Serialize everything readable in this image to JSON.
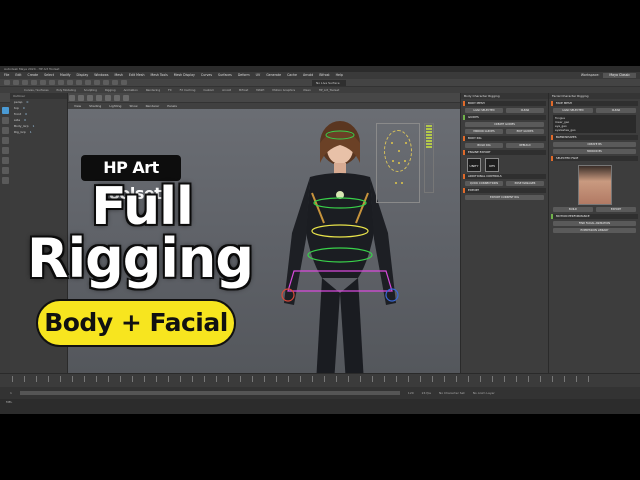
{
  "titlebar": {
    "text": "Autodesk Maya 2024 - HP Art Toolset"
  },
  "menu": {
    "items": [
      "File",
      "Edit",
      "Create",
      "Select",
      "Modify",
      "Display",
      "Windows",
      "Mesh",
      "Edit Mesh",
      "Mesh Tools",
      "Mesh Display",
      "Curves",
      "Surfaces",
      "Deform",
      "UV",
      "Generate",
      "Cache",
      "Arnold",
      "Bifrost",
      "Help"
    ],
    "workspace_label": "Workspace:",
    "workspace_value": "Maya Classic"
  },
  "live_surface": "No Live Surface",
  "shelf_tabs": [
    "Curves / Surfaces",
    "Poly Modeling",
    "Sculpting",
    "Rigging",
    "Animation",
    "Rendering",
    "FX",
    "FX Caching",
    "Custom",
    "Arnold",
    "Bifrost",
    "MASH",
    "Motion Graphics",
    "XGen",
    "HP_Art_Toolset"
  ],
  "outliner": {
    "header": "Outliner",
    "rows": [
      {
        "name": "persp",
        "v": "0"
      },
      {
        "name": "top",
        "v": "0"
      },
      {
        "name": "front",
        "v": "0"
      },
      {
        "name": "side",
        "v": "0"
      },
      {
        "name": "Body_Grp",
        "v": "1"
      },
      {
        "name": "Rig_Grp",
        "v": "1"
      }
    ]
  },
  "viewport_menu": [
    "View",
    "Shading",
    "Lighting",
    "Show",
    "Renderer",
    "Panels"
  ],
  "overlay": {
    "toolset": "HP Art Toolset",
    "line1": "Full",
    "line2": "Rigging",
    "pill": "Body + Facial"
  },
  "body_panel": {
    "title": "Body Character Rigging",
    "sections": [
      {
        "label": "BODY MESH",
        "buttons": [
          "LOAD SELECTED",
          "CLEAR"
        ]
      },
      {
        "label": "GUIDES",
        "buttons": [
          "CREATE GUIDES",
          "MIRROR GUIDES",
          "EDIT GUIDES"
        ]
      },
      {
        "label": "BODY RIG",
        "buttons": [
          "BUILD RIG",
          "REBUILD"
        ]
      },
      {
        "label": "ENGINE EXPORT",
        "buttons": [
          "UNITY",
          "UE5"
        ]
      },
      {
        "label": "ADDITIONAL CONTROLS",
        "buttons": [
          "QUICK CONNECTIONS",
          "POSE MANAGER"
        ]
      },
      {
        "label": "EXPORT",
        "buttons": [
          "EXPORT CURRENT RIG"
        ]
      }
    ]
  },
  "face_panel": {
    "title": "Facial Character Rigging",
    "sections": [
      {
        "label": "FACE MESH",
        "buttons": [
          "LOAD SELECTED",
          "CLEAR"
        ]
      },
      {
        "label": "BLENDSHAPES",
        "buttons": [
          "CREATE BS",
          "MIRROR BS"
        ]
      },
      {
        "label": "SELECTED FACE",
        "buttons": [
          "BUILD",
          "EXPORT"
        ]
      },
      {
        "label": "MOTION PERFORMANCE",
        "buttons": [
          "FIND FACIAL ANIMATION",
          "EXPRESSION LIBRARY"
        ]
      }
    ],
    "mesh_list": [
      "Tongue",
      "lower_geo",
      "eye_geo",
      "eyelashes_geo"
    ]
  },
  "timeline": {
    "start": "1",
    "end": "120",
    "fps": "24 fps",
    "character_set": "No Character Set",
    "anim_layer": "No Anim Layer"
  },
  "command_line": "MEL"
}
